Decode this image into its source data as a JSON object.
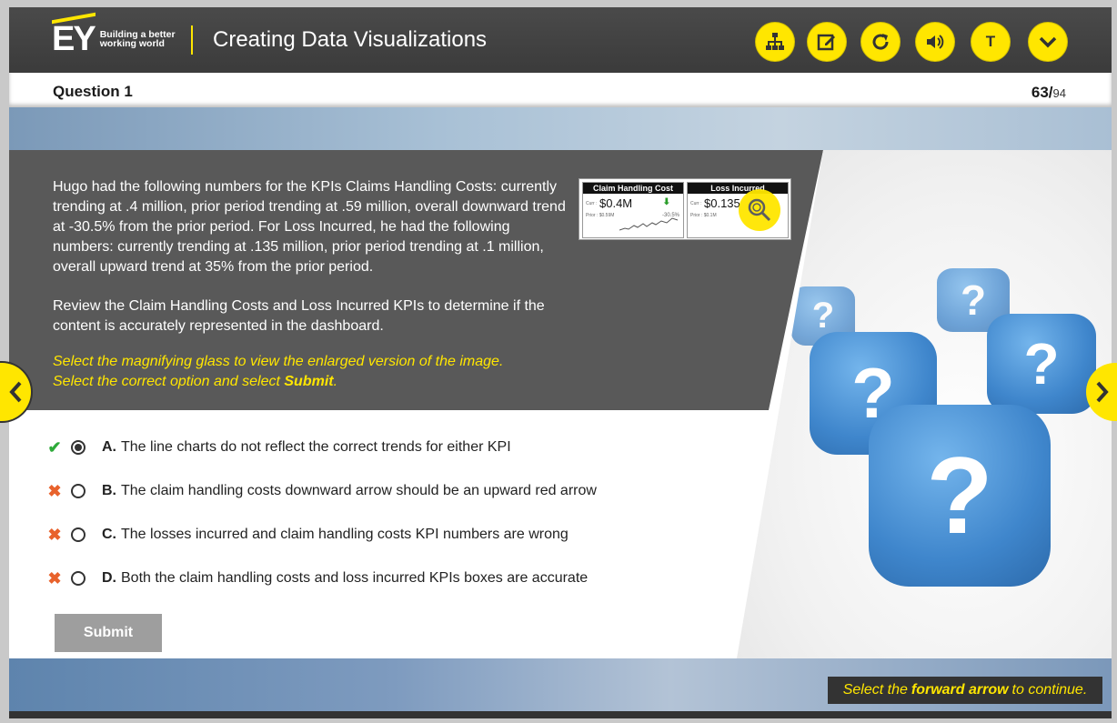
{
  "header": {
    "logo_text": "EY",
    "logo_tagline": "Building a better working world",
    "course_title": "Creating Data Visualizations",
    "buttons": [
      {
        "name": "menu",
        "icon": "sitemap-icon"
      },
      {
        "name": "notes",
        "icon": "edit-icon"
      },
      {
        "name": "replay",
        "icon": "replay-icon"
      },
      {
        "name": "audio",
        "icon": "volume-icon"
      },
      {
        "name": "transcript",
        "icon": "transcript-icon",
        "label": "T"
      },
      {
        "name": "more",
        "icon": "chevron-down-icon"
      }
    ]
  },
  "question": {
    "title": "Question 1",
    "page_current": "63/",
    "page_total": "94",
    "paragraph1": "Hugo had the following numbers for the KPIs Claims Handling Costs: currently trending at .4 million, prior period trending at .59 million, overall downward trend at -30.5% from the prior period. For Loss Incurred, he had the following numbers: currently trending at .135 million, prior period trending at .1 million, overall upward trend at 35% from the prior period.",
    "paragraph2": "Review the Claim Handling Costs and Loss Incurred KPIs to determine if the content is accurately represented in the dashboard.",
    "instruction1": "Select the magnifying glass to view the enlarged version of the image.",
    "instruction2_pre": "Select the correct option and select ",
    "instruction2_bold": "Submit",
    "instruction2_post": "."
  },
  "thumbnail": {
    "card1": {
      "title": "Claim Handling Cost",
      "value": "$0.4M",
      "curr": "Curr :",
      "prior": "Prior : $0.59M",
      "pct": "-30.5%"
    },
    "card2": {
      "title": "Loss Incurred",
      "value": "$0.135",
      "curr": "Curr :",
      "prior": "Prior : $0.1M"
    }
  },
  "options": [
    {
      "letter": "A.",
      "text": "The line charts do not reflect the correct trends for either KPI",
      "feedback": "correct",
      "selected": true
    },
    {
      "letter": "B.",
      "text": "The claim handling costs downward arrow should be an upward red arrow",
      "feedback": "incorrect",
      "selected": false
    },
    {
      "letter": "C.",
      "text": "The losses incurred and claim handling costs KPI numbers are wrong",
      "feedback": "incorrect",
      "selected": false
    },
    {
      "letter": "D.",
      "text": "Both the claim handling costs and loss incurred KPIs boxes are accurate",
      "feedback": "incorrect",
      "selected": false
    }
  ],
  "submit_label": "Submit",
  "continue": {
    "pre": "Select the",
    "bold": "forward arrow",
    "post": "to continue."
  },
  "colors": {
    "accent": "#ffe600",
    "dark_panel": "#595959",
    "correct": "#2eaa3a",
    "incorrect": "#e8622c"
  }
}
